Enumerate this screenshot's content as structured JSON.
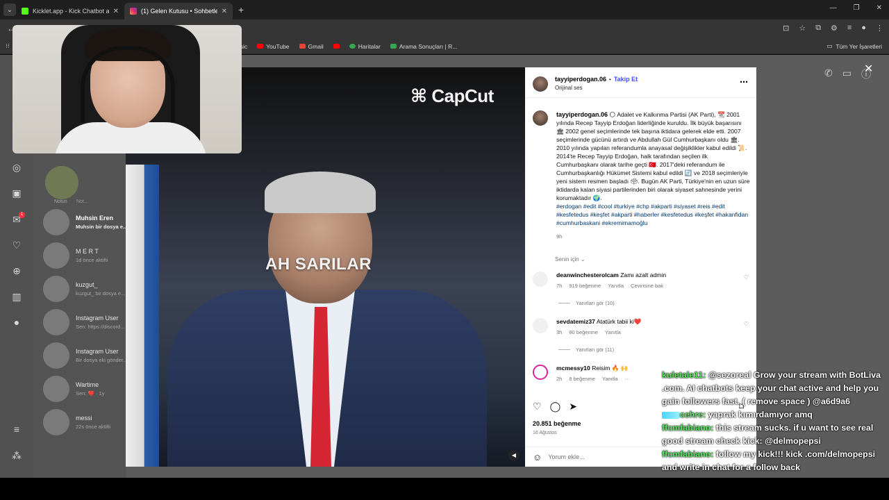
{
  "browser": {
    "tabs": [
      {
        "title": "Kicklet.app - Kick Chatbot and C",
        "close": "✕"
      },
      {
        "title": "(1) Gelen Kutusu • Sohbetle",
        "close": "✕"
      }
    ],
    "new_tab": "+",
    "window_controls": [
      "—",
      "❐",
      "✕"
    ],
    "bookmarks": [
      "sic",
      "YouTube",
      "Gmail",
      "Haritalar",
      "Arama Sonuçları | R..."
    ],
    "bookmarks_right": "Tüm Yer İşaretleri"
  },
  "sidebar": {
    "notification_count": "1"
  },
  "dm_list": {
    "note_label": "Not...",
    "note_user": "Notun",
    "items": [
      {
        "name": "Muhsin Eren",
        "preview": "Muhsin bir dosya e...",
        "unread": true
      },
      {
        "name": "M E R T",
        "preview": "1d önce aktifti"
      },
      {
        "name": "kuzgut_",
        "preview": "kuzgut_ bir dosya e..."
      },
      {
        "name": "Instagram User",
        "preview": "Sen: https://discord..."
      },
      {
        "name": "Instagram User",
        "preview": "Bir dosya eki gönder..."
      },
      {
        "name": "Wartime",
        "preview": "Sen: ❤️ · 1y"
      },
      {
        "name": "messi",
        "preview": "22s önce aktifti"
      }
    ]
  },
  "video": {
    "watermark": "CapCut",
    "overlay_text": "AH SARILAR"
  },
  "post": {
    "username": "tayyiperdogan.06",
    "follow_label": "Takip Et",
    "audio": "Orijinal ses",
    "caption_user": "tayyiperdogan.06",
    "caption": "🌕 Adalet ve Kalkınma Partisi (AK Parti), 📆 2001 yılında Recep Tayyip Erdoğan liderliğinde kuruldu. İlk büyük başarısını 🏛 2002 genel seçimlerinde tek başına iktidara gelerek elde etti. 2007 seçimlerinde gücünü artırdı ve Abdullah Gül Cumhurbaşkanı oldu 🏛. 2010 yılında yapılan referandumla anayasal değişiklikler kabul edildi 📜. 2014'te Recep Tayyip Erdoğan, halk tarafından seçilen ilk Cumhurbaşkanı olarak tarihe geçti 🇹🇷. 2017'deki referandum ile Cumhurbaşkanlığı Hükümet Sistemi kabul edildi 🔄 ve 2018 seçimleriyle yeni sistem resmen başladı 🗳. Bugün AK Parti, Türkiye'nin en uzun süre iktidarda kalan siyasi partilerinden biri olarak siyaset sahnesinde yerini korumaktadır 🌍.",
    "hashtags": "#erdogan #edit #cool #turkiye #chp #akparti #siyaset #reis #edit #kesfetedus #keşfet #akparti #haberler #kesfetedus #keşfet #hakanfidan #cumhurbaskani #ekremimamoğlu",
    "caption_time": "9h",
    "sort_label": "Senin için ⌄",
    "comments": [
      {
        "user": "deanwinchesterolcam",
        "text": "Zamı azalt admin",
        "time": "7h",
        "likes": "919 beğenme",
        "reply": "Yanıtla",
        "translate": "Çevirisine bak",
        "replies": "Yanıtları gör (10)"
      },
      {
        "user": "sevdatemiz37",
        "text": "Atatürk tabii ki❤️",
        "time": "3h",
        "likes": "80 beğenme",
        "reply": "Yanıtla",
        "replies": "Yanıtları gör (11)"
      },
      {
        "user": "mcmessy10",
        "text": "Reisim 🔥 🙌",
        "time": "2h",
        "likes": "8 beğenme",
        "reply": "Yanıtla",
        "more": "···"
      }
    ],
    "like_count": "20.851 beğenme",
    "date": "16 Ağustos",
    "add_comment_placeholder": "Yorum ekle..."
  },
  "chat": [
    {
      "user": "kuletale11:",
      "message": " @sezoreal Grow your stream with BotLiva .com. AI chatbots keep your chat active and help you gain followers fast. ( remove space ) @a6d9a6"
    },
    {
      "user": "cehre:",
      "message": " yaprak kımırdamıyor amq"
    },
    {
      "user": "ffcmfabiano:",
      "message": " this stream sucks. if u want to see real good stream check kick: @delmopepsi"
    },
    {
      "user": "ffcmfabiano:",
      "message": " follow my kick!!! kick .com/delmopepsi and write in chat for a follow back"
    }
  ],
  "icons": {
    "back": "←",
    "menu": "⋯",
    "heart": "♡",
    "comment": "◯",
    "share": "➤",
    "bookmark": "⌑",
    "emoji": "☺",
    "mute": "🔇",
    "close": "✕",
    "phone": "✆",
    "video_call": "▭",
    "info": "ⓘ"
  }
}
